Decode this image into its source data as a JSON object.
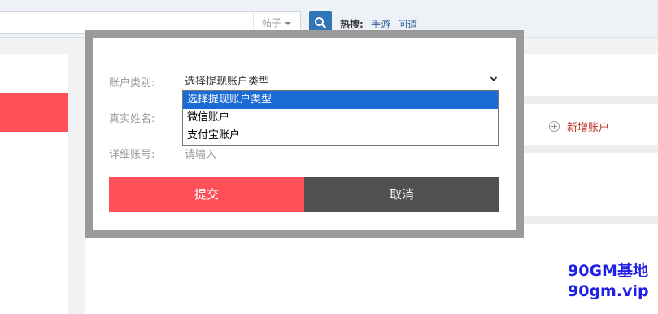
{
  "topbar": {
    "search_type": "帖子",
    "hot_label": "热搜:",
    "hot_links": [
      "手游",
      "问道"
    ]
  },
  "sidebar": {
    "add_account_label": "新增账户"
  },
  "watermark": {
    "line1": "90GM基地",
    "line2": "90gm.vip"
  },
  "modal": {
    "account_type_label": "账户类别:",
    "account_type_value": "选择提现账户类型",
    "account_type_options": [
      "选择提现账户类型",
      "微信账户",
      "支付宝账户"
    ],
    "real_name_label": "真实姓名:",
    "account_number_label": "详细账号:",
    "account_number_placeholder": "请输入",
    "submit_label": "提交",
    "cancel_label": "取消"
  },
  "colors": {
    "accent_red": "#ff4f58",
    "cancel_gray": "#505050",
    "search_blue": "#2f76b7",
    "select_highlight": "#1a6bd4",
    "watermark_blue": "#1f1fe6"
  }
}
